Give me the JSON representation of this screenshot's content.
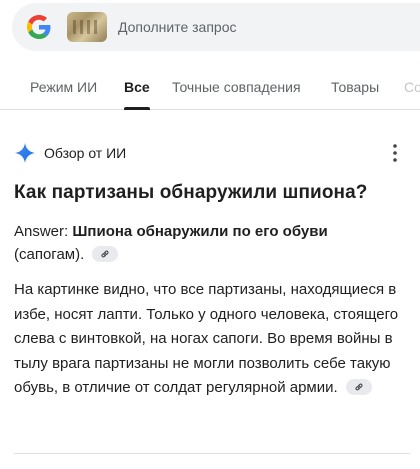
{
  "search": {
    "placeholder": "Дополните запрос",
    "logo_icon": "google-g-icon",
    "thumbnail_icon": "image-thumbnail"
  },
  "tabs": [
    {
      "label": "Режим ИИ",
      "active": false
    },
    {
      "label": "Все",
      "active": true
    },
    {
      "label": "Точные совпадения",
      "active": false
    },
    {
      "label": "Товары",
      "active": false
    },
    {
      "label": "Со",
      "active": false
    }
  ],
  "ai_overview": {
    "title": "Обзор от ИИ",
    "icon": "sparkle-icon",
    "menu_icon": "more-vert-icon",
    "question": "Как партизаны обнаружили шпиона?",
    "answer_prefix": "Answer: ",
    "answer_bold": "Шпиона обнаружили по его обуви",
    "answer_rest": "(сапогам).",
    "body": "На картинке видно, что все партизаны, находящиеся в избе, носят лапти. Только у одного человека, стоящего слева с винтовкой, на ногах сапоги. Во время войны в тылу врага партизаны не могли позволить себе такую обувь, в отличие от солдат регулярной армии."
  },
  "colors": {
    "accent": "#1f1f1f",
    "muted": "#5f6368",
    "search_bg": "#f1f3f4",
    "spark_blue": "#4285f4"
  }
}
